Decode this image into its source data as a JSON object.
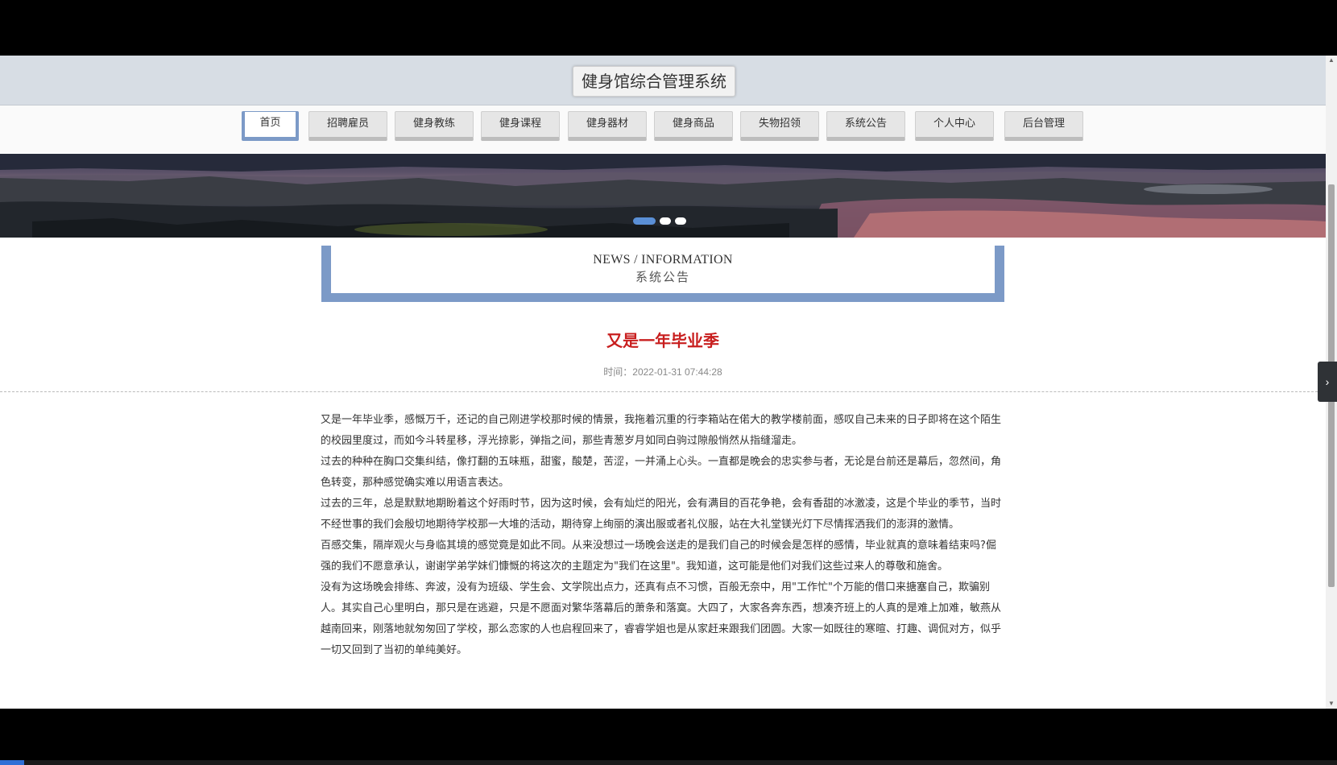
{
  "header": {
    "title": "健身馆综合管理系统"
  },
  "nav": {
    "items": [
      {
        "label": "首页",
        "active": true
      },
      {
        "label": "招聘雇员"
      },
      {
        "label": "健身教练"
      },
      {
        "label": "健身课程"
      },
      {
        "label": "健身器材"
      },
      {
        "label": "健身商品"
      },
      {
        "label": "失物招领"
      },
      {
        "label": "系统公告"
      },
      {
        "label": "个人中心"
      },
      {
        "label": "后台管理"
      }
    ]
  },
  "carousel": {
    "slide_count": 3,
    "active_index": 0
  },
  "section": {
    "title_en": "NEWS / INFORMATION",
    "title_cn": "系统公告"
  },
  "article": {
    "title": "又是一年毕业季",
    "time": "时间：2022-01-31 07:44:28",
    "paragraphs": [
      "又是一年毕业季，感慨万千，还记的自己刚进学校那时候的情景，我拖着沉重的行李箱站在偌大的教学楼前面，感叹自己未来的日子即将在这个陌生的校园里度过，而如今斗转星移，浮光掠影，弹指之间，那些青葱岁月如同白驹过隙般悄然从指缝溜走。",
      "过去的种种在胸口交集纠结，像打翻的五味瓶，甜蜜，酸楚，苦涩，一并涌上心头。一直都是晚会的忠实参与者，无论是台前还是幕后，忽然间，角色转变，那种感觉确实难以用语言表达。",
      "过去的三年，总是默默地期盼着这个好雨时节，因为这时候，会有灿烂的阳光，会有满目的百花争艳，会有香甜的冰激凌，这是个毕业的季节，当时不经世事的我们会殷切地期待学校那一大堆的活动，期待穿上绚丽的演出服或者礼仪服，站在大礼堂镁光灯下尽情挥洒我们的澎湃的激情。",
      "百感交集，隔岸观火与身临其境的感觉竟是如此不同。从来没想过一场晚会送走的是我们自己的时候会是怎样的感情，毕业就真的意味着结束吗?倔强的我们不愿意承认，谢谢学弟学妹们慷慨的将这次的主题定为\"我们在这里\"。我知道，这可能是他们对我们这些过来人的尊敬和施舍。",
      "没有为这场晚会排练、奔波，没有为班级、学生会、文学院出点力，还真有点不习惯，百般无奈中，用\"工作忙\"个万能的借口来搪塞自己，欺骗别人。其实自己心里明白，那只是在逃避，只是不愿面对繁华落幕后的萧条和落寞。大四了，大家各奔东西，想凑齐班上的人真的是难上加难，敏燕从越南回来，刚落地就匆匆回了学校，那么恋家的人也启程回来了，睿睿学姐也是从家赶来跟我们团圆。大家一如既往的寒暄、打趣、调侃对方，似乎一切又回到了当初的单纯美好。"
    ]
  },
  "colors": {
    "accent": "#7c9ac7",
    "title_red": "#c81e1e"
  },
  "icons": {
    "side_handle": "chevron-right-icon"
  }
}
